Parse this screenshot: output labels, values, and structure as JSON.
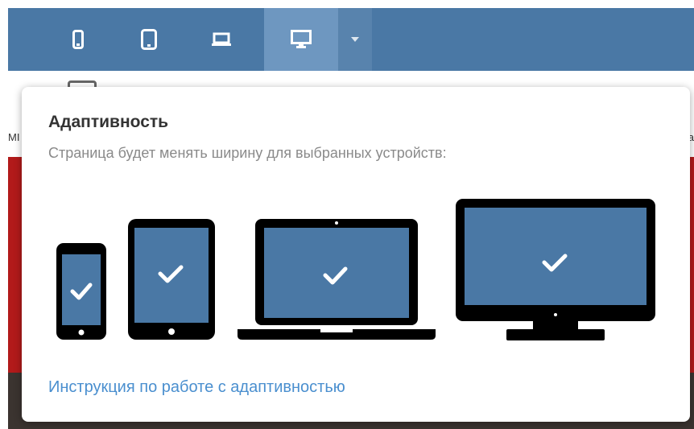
{
  "toolbar": {
    "buttons": [
      {
        "name": "phone-view-button",
        "icon": "phone-icon",
        "active": false
      },
      {
        "name": "tablet-view-button",
        "icon": "tablet-icon",
        "active": false
      },
      {
        "name": "laptop-view-button",
        "icon": "laptop-icon",
        "active": false
      },
      {
        "name": "desktop-view-button",
        "icon": "desktop-monitor-icon",
        "active": true
      },
      {
        "name": "dropdown-caret-button",
        "icon": "caret-down-icon",
        "active": false
      }
    ],
    "background_color": "#4a78a5",
    "active_color": "#6e97c0"
  },
  "background": {
    "left_text": "МІ",
    "right_text": "а"
  },
  "popup": {
    "title": "Адаптивность",
    "subtitle": "Страница будет менять ширину для выбранных устройств:",
    "devices": [
      {
        "name": "phone",
        "icon": "phone-icon",
        "checked": true
      },
      {
        "name": "tablet",
        "icon": "tablet-icon",
        "checked": true
      },
      {
        "name": "laptop",
        "icon": "laptop-icon",
        "checked": true
      },
      {
        "name": "desktop",
        "icon": "desktop-monitor-icon",
        "checked": true
      }
    ],
    "link_text": "Инструкция по работе с адаптивностью",
    "screen_color": "#4a78a5",
    "link_color": "#4a8fcf"
  }
}
